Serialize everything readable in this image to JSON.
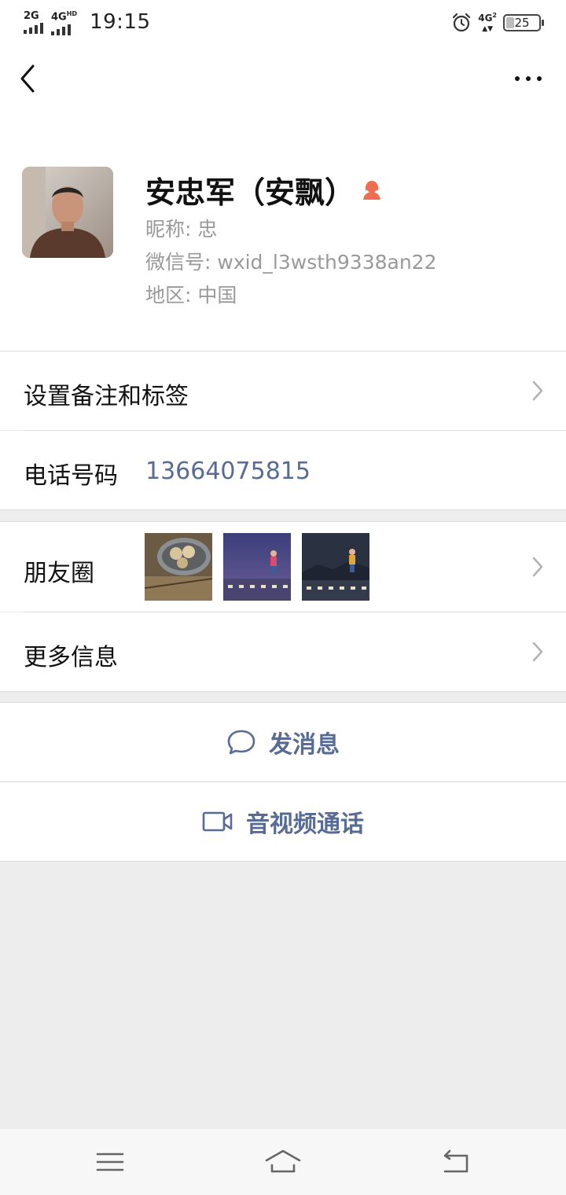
{
  "status_bar": {
    "signal1_label": "2G",
    "signal2_label": "4G",
    "signal2_sup": "HD",
    "time": "19:15",
    "network_label": "4G",
    "network_sub": "2",
    "battery": "25",
    "icons": [
      "signal-icon",
      "alarm-icon",
      "battery-icon"
    ]
  },
  "nav": {
    "back_icon": "chevron-left-icon",
    "more_icon": "more-dots-icon"
  },
  "profile": {
    "name": "安忠军（安飘）",
    "gender_icon": "female-icon",
    "nickname": "昵称:  忠",
    "wechat_id": "微信号:  wxid_l3wsth9338an22",
    "region": "地区:  中国"
  },
  "rows": {
    "remark_tags": "设置备注和标签",
    "phone_label": "电话号码",
    "phone_value": "13664075815",
    "moments_label": "朋友圈",
    "more_info": "更多信息"
  },
  "actions": {
    "message": "发消息",
    "video_call": "音视频通话"
  },
  "system_nav": [
    "menu-icon",
    "home-icon",
    "back-icon"
  ],
  "colors": {
    "link_blue": "#576b95",
    "background": "#ededed",
    "female_orange": "#f06e4f"
  }
}
